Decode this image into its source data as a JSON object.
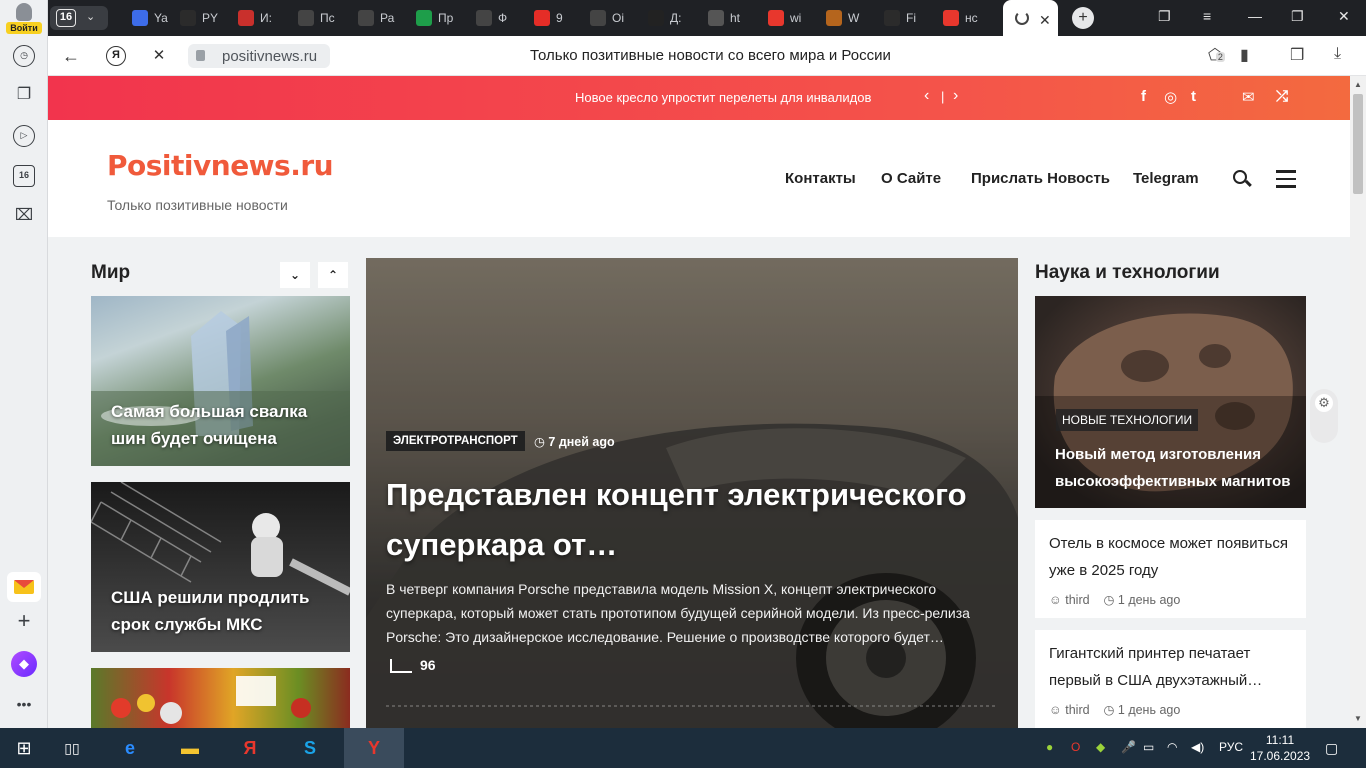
{
  "browser": {
    "login_label": "Войти",
    "sidebar_badge": "16",
    "tab_count": "16",
    "tabs": [
      {
        "label": "Ya",
        "icon": "chart-icon",
        "color": "#3d6ce8"
      },
      {
        "label": "PY",
        "icon": "github-icon",
        "color": "#2b2b2b"
      },
      {
        "label": "И:",
        "icon": "flag-icon",
        "color": "#c9302c"
      },
      {
        "label": "Пс",
        "icon": "refresh-icon",
        "color": "#444"
      },
      {
        "label": "Ра",
        "icon": "openai-icon",
        "color": "#444"
      },
      {
        "label": "Пр",
        "icon": "sheets-icon",
        "color": "#1e9e4a"
      },
      {
        "label": "Ф",
        "icon": "openai-icon",
        "color": "#444"
      },
      {
        "label": "9",
        "icon": "youtube-icon",
        "color": "#e52d27"
      },
      {
        "label": "Oi",
        "icon": "openai-icon",
        "color": "#444"
      },
      {
        "label": "Д:",
        "icon": "star-icon",
        "color": "#222"
      },
      {
        "label": "ht",
        "icon": "page-icon",
        "color": "#555"
      },
      {
        "label": "wi",
        "icon": "yandex-icon",
        "color": "#e8372d"
      },
      {
        "label": "W",
        "icon": "wiki-icon",
        "color": "#b5651d"
      },
      {
        "label": "Fi",
        "icon": "github-icon",
        "color": "#2b2b2b"
      },
      {
        "label": "нс",
        "icon": "yandex-icon",
        "color": "#e8372d"
      }
    ],
    "url": "positivnews.ru",
    "page_title": "Только позитивные новости со всего мира и России",
    "ext_badge": "2"
  },
  "site": {
    "ticker": "Новое кресло упростит перелеты для инвалидов",
    "tick_sep": "|",
    "logo": "Positivnews.ru",
    "tagline": "Только позитивные новости",
    "nav": [
      "Контакты",
      "О Сайте",
      "Прислать Новость",
      "Telegram"
    ],
    "social": [
      "f",
      "◎",
      "t",
      "✉",
      "⤮"
    ],
    "brand_color": "#f05a3b"
  },
  "left_section": {
    "title": "Мир",
    "cards": [
      "Самая большая свалка шин будет очищена",
      "США решили продлить срок службы МКС",
      ""
    ]
  },
  "feature": {
    "tag": "ЭЛЕКТРОТРАНСПОРТ",
    "date": "7 дней ago",
    "title": "Представлен концепт электрического суперкара от…",
    "excerpt": "В четверг компания Porsche представила модель Mission X, концепт электрического суперкара, который может стать прототипом будущей серийной модели. Из пресс-релиза Porsche: Это дизайнерское исследование. Решение о производстве которого будет…",
    "views": "96"
  },
  "right_section": {
    "title": "Наука и технологии",
    "top_card": {
      "tag": "НОВЫЕ ТЕХНОЛОГИИ",
      "title": "Новый метод изготовления высокоэффективных магнитов"
    },
    "list": [
      {
        "title": "Отель в космосе может появиться уже в 2025 году",
        "author": "third",
        "date": "1 день ago"
      },
      {
        "title": "Гигантский принтер печатает первый в США двухэтажный…",
        "author": "third",
        "date": "1 день ago"
      }
    ]
  },
  "taskbar": {
    "lang": "РУС",
    "time": "11:11",
    "date": "17.06.2023"
  }
}
